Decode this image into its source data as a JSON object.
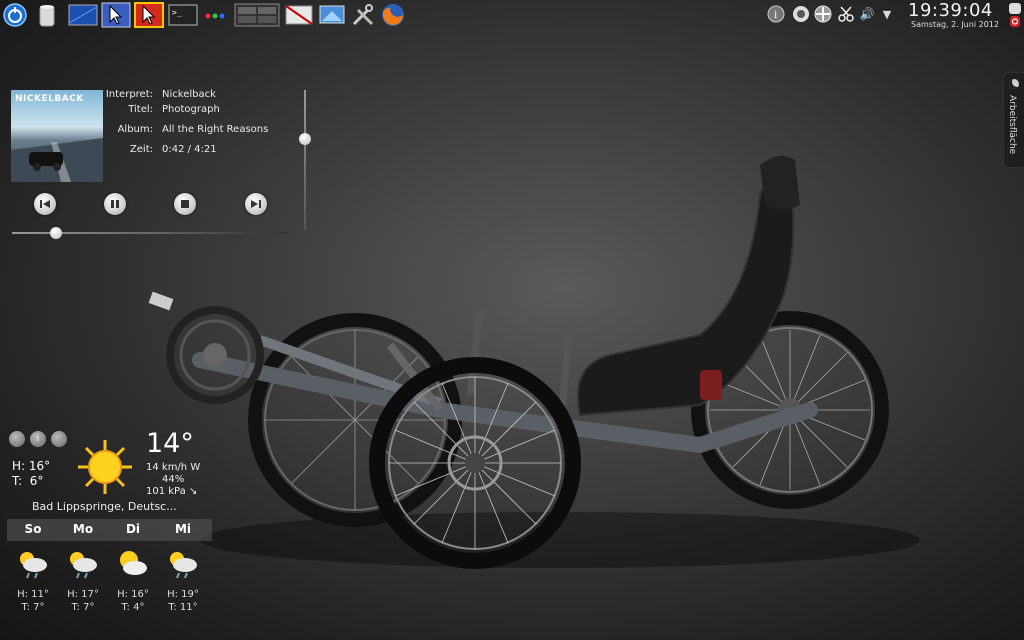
{
  "panel": {
    "launchers": [
      {
        "icon": "kde-menu-icon"
      },
      {
        "icon": "trash-icon"
      },
      {
        "icon": "desktop-icon"
      },
      {
        "icon": "cursor-theme-blue-icon"
      },
      {
        "icon": "cursor-theme-red-icon"
      },
      {
        "icon": "terminal-icon"
      },
      {
        "icon": "color-dots-icon"
      },
      {
        "icon": "window-switcher-icon"
      },
      {
        "icon": "no-display-icon"
      },
      {
        "icon": "screen-icon"
      },
      {
        "icon": "tools-icon"
      },
      {
        "icon": "firefox-icon"
      }
    ],
    "tray": [
      {
        "icon": "info-icon"
      },
      {
        "icon": "network-icon"
      },
      {
        "icon": "nepomuk-icon"
      },
      {
        "icon": "scissors-icon"
      },
      {
        "icon": "volume-icon",
        "glyph": "🔊"
      },
      {
        "icon": "tray-expand-icon",
        "glyph": "▼"
      }
    ],
    "clock": {
      "time": "19:39:04",
      "date": "Samstag, 2. Juni 2012"
    }
  },
  "side_tab": {
    "label": "Arbeitsfläche"
  },
  "media": {
    "cover_text": "NICKELBACK",
    "fields": [
      {
        "key": "Interpret:",
        "value": "Nickelback"
      },
      {
        "key": "Titel:",
        "value": "Photograph"
      },
      {
        "key": "Album:",
        "value": "All the Right Reasons"
      },
      {
        "key": "Zeit:",
        "value": "0:42 / 4:21"
      }
    ],
    "volume_fraction": 0.35,
    "seek_fraction": 0.16
  },
  "weather": {
    "temp": "14°",
    "wind": "14 km/h W",
    "humidity": "44%",
    "pressure": "101 kPa ↘",
    "high_label": "H:",
    "high": "16°",
    "low_label": "T:",
    "low": "6°",
    "city": "Bad Lippspringe, Deutsc...",
    "forecast": [
      {
        "day": "So",
        "high": "H: 11°",
        "low": "T: 7°"
      },
      {
        "day": "Mo",
        "high": "H: 17°",
        "low": "T: 7°"
      },
      {
        "day": "Di",
        "high": "H: 16°",
        "low": "T: 4°"
      },
      {
        "day": "Mi",
        "high": "H: 19°",
        "low": "T: 11°"
      }
    ]
  }
}
